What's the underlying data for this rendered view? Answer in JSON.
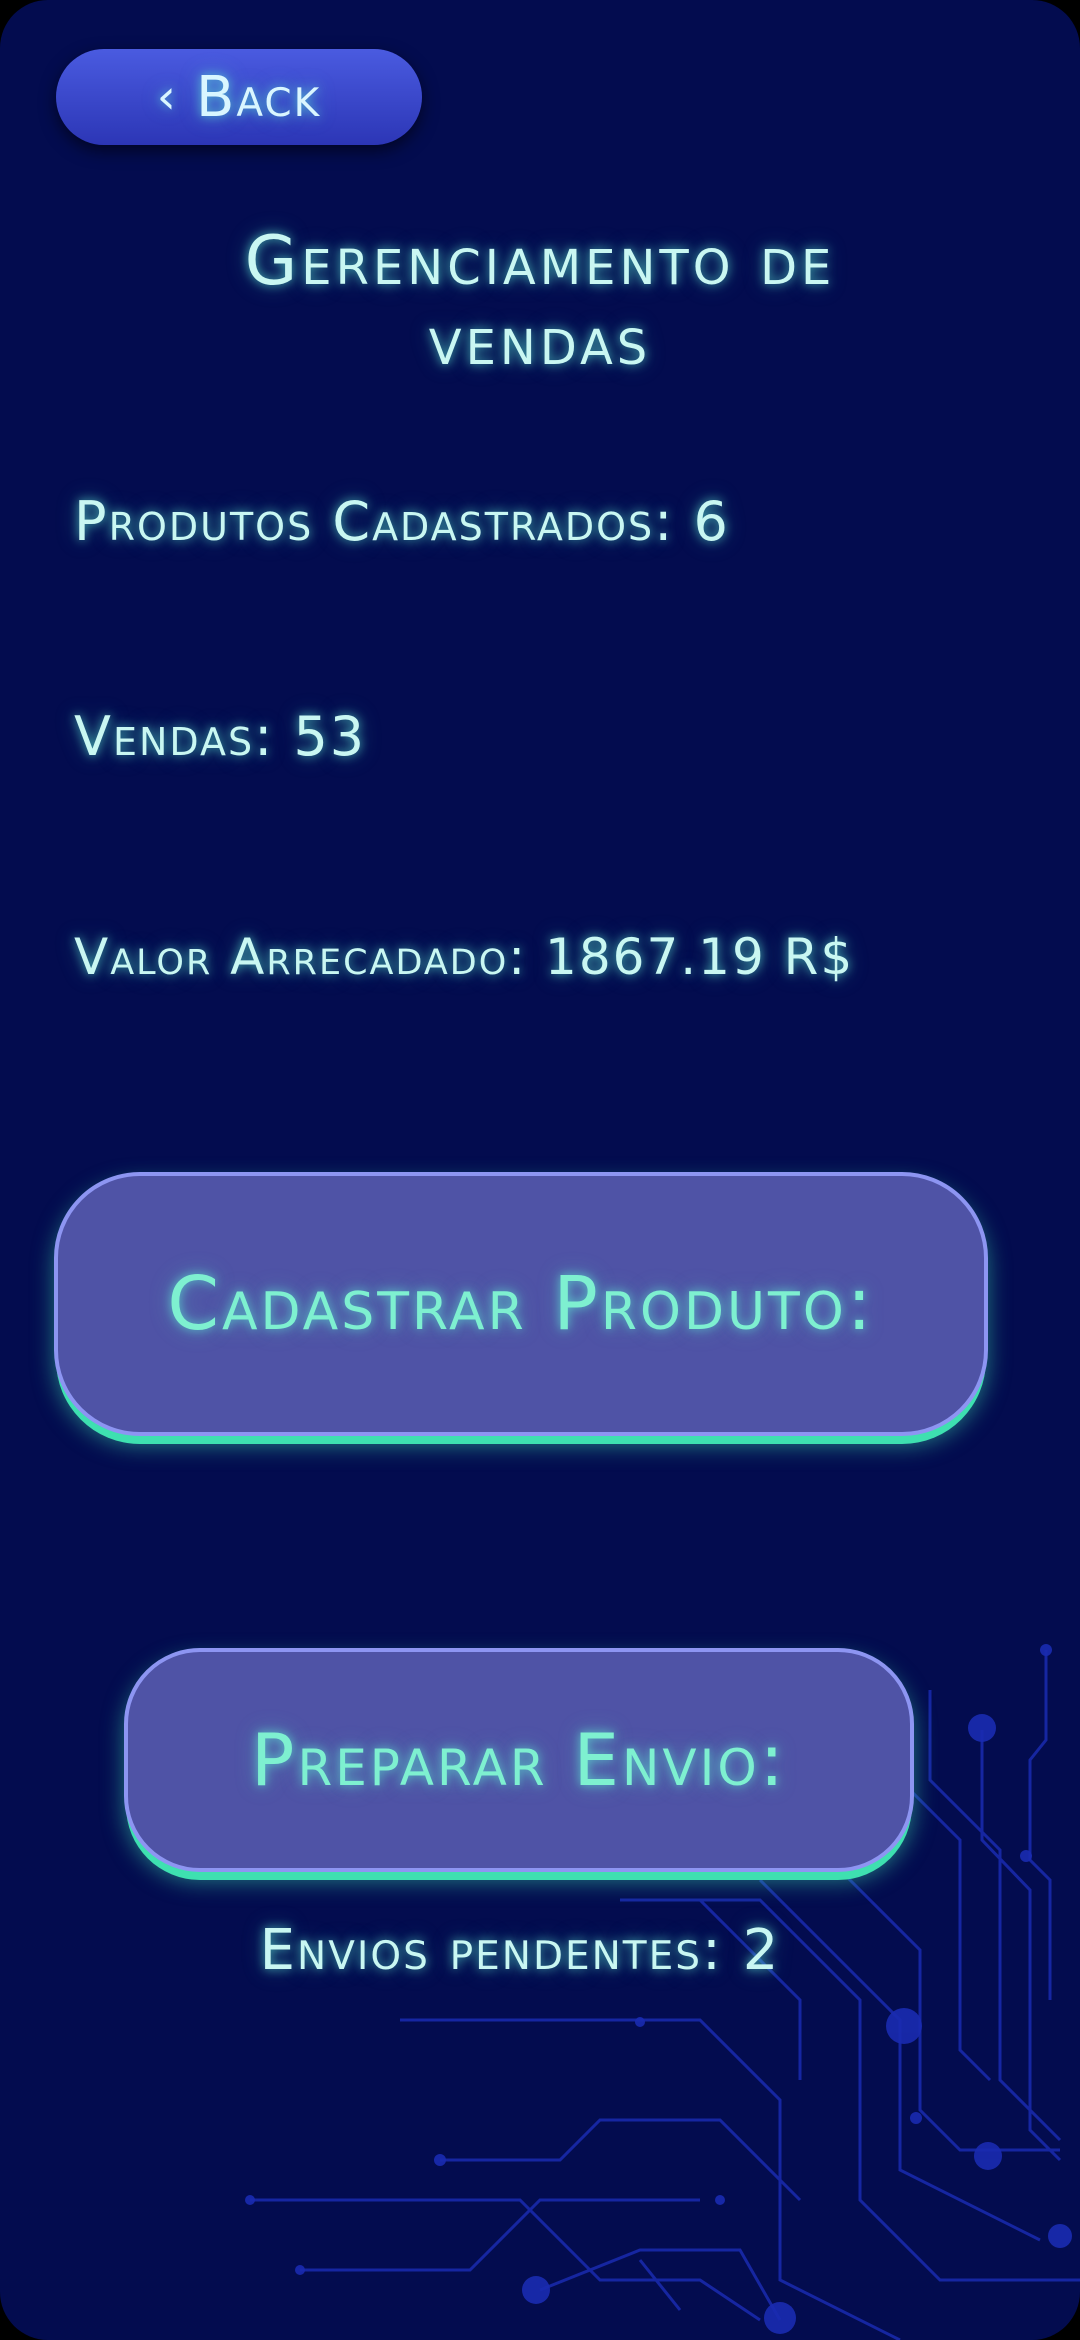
{
  "header": {
    "back_label": "Back",
    "back_icon": "chevron-left-icon"
  },
  "page": {
    "title": "Gerenciamento de vendas"
  },
  "stats": {
    "produtos": "Produtos Cadastrados: 6",
    "vendas": "Vendas: 53",
    "valor": "Valor Arrecadado: 1867.19 R$"
  },
  "actions": {
    "cadastrar_label": "Cadastrar Produto:",
    "preparar_label": "Preparar Envio:"
  },
  "status": {
    "envios_pendentes": "Envios pendentes: 2"
  },
  "colors": {
    "background": "#030c4f",
    "text": "#c9f7f2",
    "accent": "#3ee0b0",
    "button_fill": "#4f53a6",
    "button_border": "#8d95f2",
    "back_button": "#3a48cc"
  }
}
